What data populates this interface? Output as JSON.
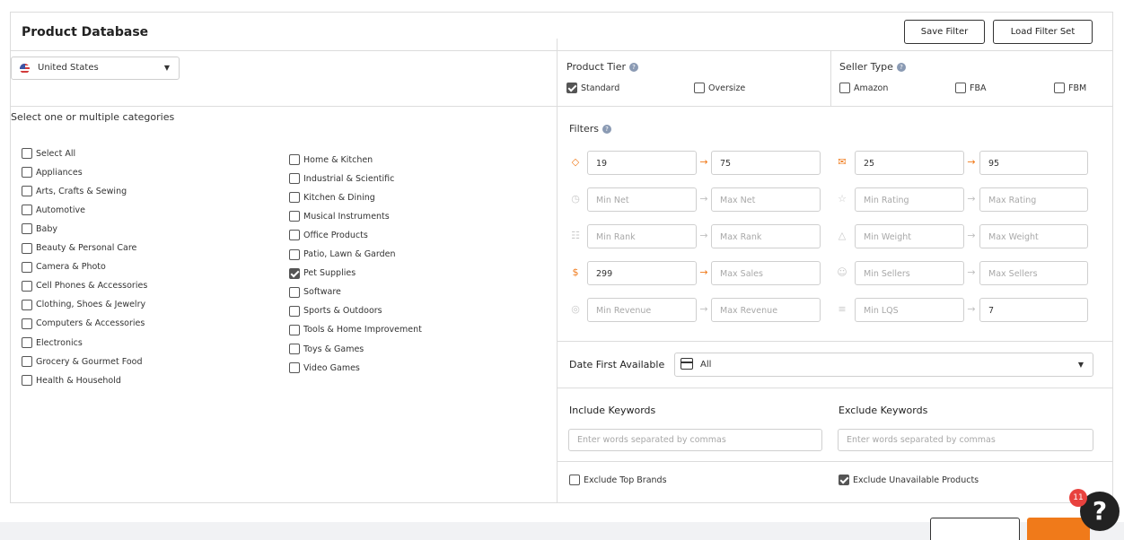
{
  "header": {
    "title": "Product Database",
    "save_filter": "Save Filter",
    "load_filter_set": "Load Filter Set"
  },
  "country": {
    "selected": "United States",
    "flag_icon": "us-flag-icon"
  },
  "categories": {
    "heading": "Select one or multiple categories",
    "col1": [
      {
        "label": "Select All",
        "checked": false
      },
      {
        "label": "Appliances",
        "checked": false
      },
      {
        "label": "Arts, Crafts & Sewing",
        "checked": false
      },
      {
        "label": "Automotive",
        "checked": false
      },
      {
        "label": "Baby",
        "checked": false
      },
      {
        "label": "Beauty & Personal Care",
        "checked": false
      },
      {
        "label": "Camera & Photo",
        "checked": false
      },
      {
        "label": "Cell Phones & Accessories",
        "checked": false
      },
      {
        "label": "Clothing, Shoes & Jewelry",
        "checked": false
      },
      {
        "label": "Computers & Accessories",
        "checked": false
      },
      {
        "label": "Electronics",
        "checked": false
      },
      {
        "label": "Grocery & Gourmet Food",
        "checked": false
      },
      {
        "label": "Health & Household",
        "checked": false
      }
    ],
    "col2": [
      {
        "label": "Home & Kitchen",
        "checked": false
      },
      {
        "label": "Industrial & Scientific",
        "checked": false
      },
      {
        "label": "Kitchen & Dining",
        "checked": false
      },
      {
        "label": "Musical Instruments",
        "checked": false
      },
      {
        "label": "Office Products",
        "checked": false
      },
      {
        "label": "Patio, Lawn & Garden",
        "checked": false
      },
      {
        "label": "Pet Supplies",
        "checked": true
      },
      {
        "label": "Software",
        "checked": false
      },
      {
        "label": "Sports & Outdoors",
        "checked": false
      },
      {
        "label": "Tools & Home Improvement",
        "checked": false
      },
      {
        "label": "Toys & Games",
        "checked": false
      },
      {
        "label": "Video Games",
        "checked": false
      }
    ]
  },
  "product_tier": {
    "title": "Product Tier",
    "options": [
      {
        "label": "Standard",
        "checked": true
      },
      {
        "label": "Oversize",
        "checked": false
      }
    ]
  },
  "seller_type": {
    "title": "Seller Type",
    "options": [
      {
        "label": "Amazon",
        "checked": false
      },
      {
        "label": "FBA",
        "checked": false
      },
      {
        "label": "FBM",
        "checked": false
      }
    ]
  },
  "filters": {
    "title": "Filters",
    "left": [
      {
        "icon": "price-tag-icon",
        "min": "19",
        "max": "75",
        "active": true
      },
      {
        "icon": "net-icon",
        "min": "Min Net",
        "max": "Max Net",
        "active": false
      },
      {
        "icon": "rank-icon",
        "min": "Min Rank",
        "max": "Max Rank",
        "active": false
      },
      {
        "icon": "sales-icon",
        "min": "299",
        "max": "Max Sales",
        "active": true,
        "max_empty": true
      },
      {
        "icon": "revenue-icon",
        "min": "Min Revenue",
        "max": "Max Revenue",
        "active": false
      }
    ],
    "right": [
      {
        "icon": "reviews-icon",
        "min": "25",
        "max": "95",
        "active": true
      },
      {
        "icon": "star-icon",
        "min": "Min Rating",
        "max": "Max Rating",
        "active": false
      },
      {
        "icon": "weight-icon",
        "min": "Min Weight",
        "max": "Max Weight",
        "active": false
      },
      {
        "icon": "sellers-icon",
        "min": "Min Sellers",
        "max": "Max Sellers",
        "active": false
      },
      {
        "icon": "lqs-icon",
        "min": "Min LQS",
        "max": "7",
        "active": false,
        "max_filled": true
      }
    ]
  },
  "date_first_available": {
    "label": "Date First Available",
    "value": "All"
  },
  "include_keywords": {
    "label": "Include Keywords",
    "placeholder": "Enter words separated by commas"
  },
  "exclude_keywords": {
    "label": "Exclude Keywords",
    "placeholder": "Enter words separated by commas"
  },
  "options": {
    "exclude_top_brands": {
      "label": "Exclude Top Brands",
      "checked": false
    },
    "exclude_unavailable": {
      "label": "Exclude Unavailable Products",
      "checked": true
    }
  },
  "help": {
    "badge_count": "11",
    "symbol": "?"
  },
  "colors": {
    "accent": "#f07a1a",
    "border": "#dcdcdc",
    "badge": "#e8423e"
  }
}
